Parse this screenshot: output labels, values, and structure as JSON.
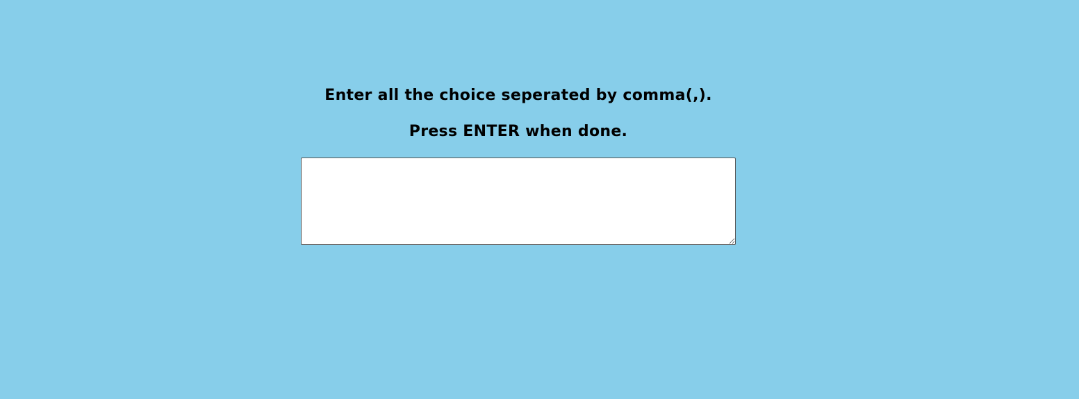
{
  "instructions": {
    "line1": "Enter all the choice seperated by comma(,).",
    "line2": "Press ENTER when done."
  },
  "choices_input": {
    "value": "",
    "placeholder": ""
  },
  "colors": {
    "background": "#87ceea",
    "text": "#000000",
    "input_background": "#ffffff"
  }
}
